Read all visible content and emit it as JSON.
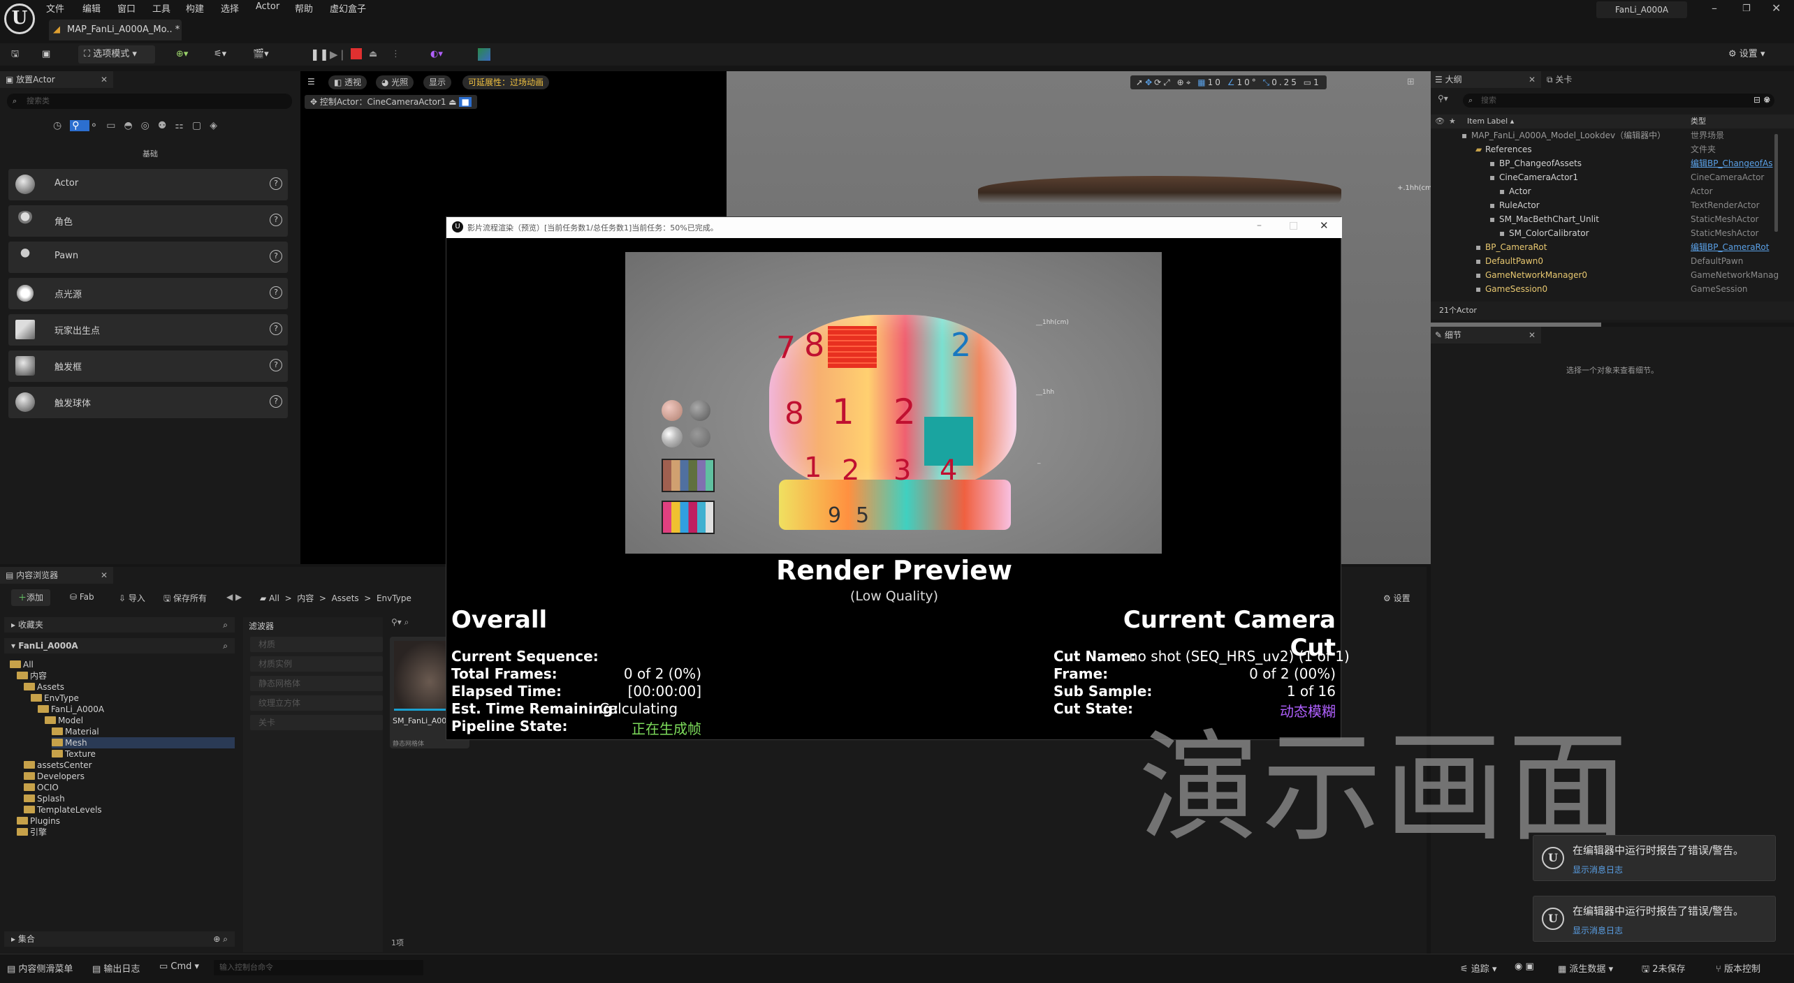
{
  "menu": [
    "文件",
    "编辑",
    "窗口",
    "工具",
    "构建",
    "选择",
    "Actor",
    "帮助",
    "虚幻盒子"
  ],
  "level_tab": "MAP_FanLi_A000A_Mo..",
  "project_name": "FanLi_A000A",
  "toolbar": {
    "mode": "选项模式",
    "settings": "设置"
  },
  "place_actors": {
    "title": "放置Actor",
    "search_placeholder": "搜索类",
    "category": "基础",
    "items": [
      "Actor",
      "角色",
      "Pawn",
      "点光源",
      "玩家出生点",
      "触发框",
      "触发球体"
    ]
  },
  "viewport": {
    "perspective": "透视",
    "lit": "光照",
    "show": "显示",
    "scalability": "可延展性：过场动画",
    "pilot": "控制Actor：CineCameraActor1",
    "grid": "10",
    "angle": "10°",
    "scale": "0.25",
    "camera_speed": "1",
    "overlay_text": "+.1hh(cm)"
  },
  "outliner": {
    "title": "大纲",
    "tab2": "关卡",
    "search_placeholder": "搜索",
    "col_label": "Item Label ▴",
    "col_type": "类型",
    "count": "21个Actor",
    "rows": [
      {
        "label": "MAP_FanLi_A000A_Model_Lookdev（编辑器中）",
        "type": "世界场景",
        "link": false,
        "dim": true
      },
      {
        "label": "References",
        "type": "文件夹",
        "link": false,
        "dim": false
      },
      {
        "label": "BP_ChangeofAssets",
        "type": "编辑BP_ChangeofAs",
        "link": true,
        "dim": false
      },
      {
        "label": "CineCameraActor1",
        "type": "CineCameraActor",
        "link": false,
        "dim": false
      },
      {
        "label": "Actor",
        "type": "Actor",
        "link": false,
        "dim": false
      },
      {
        "label": "RuleActor",
        "type": "TextRenderActor",
        "link": false,
        "dim": false
      },
      {
        "label": "SM_MacBethChart_Unlit",
        "type": "StaticMeshActor",
        "link": false,
        "dim": false
      },
      {
        "label": "SM_ColorCalibrator",
        "type": "StaticMeshActor",
        "link": false,
        "dim": false
      },
      {
        "label": "BP_CameraRot",
        "type": "编辑BP_CameraRot",
        "link": true,
        "dim": false
      },
      {
        "label": "DefaultPawn0",
        "type": "DefaultPawn",
        "link": false,
        "dim": false
      },
      {
        "label": "GameNetworkManager0",
        "type": "GameNetworkManag",
        "link": false,
        "dim": false
      },
      {
        "label": "GameSession0",
        "type": "GameSession",
        "link": false,
        "dim": false
      }
    ]
  },
  "details": {
    "title": "细节",
    "hint": "选择一个对象来查看细节。"
  },
  "content_browser": {
    "title": "内容浏览器",
    "add": "添加",
    "fab": "Fab",
    "import": "导入",
    "save_all": "保存所有",
    "path": [
      "All",
      "内容",
      "Assets",
      "EnvType"
    ],
    "settings": "设置",
    "favorites": "收藏夹",
    "project": "FanLi_A000A",
    "filters": "滤波器",
    "filter_items": [
      "材质",
      "材质实例",
      "静态网格体",
      "纹理立方体",
      "关卡"
    ],
    "tree": [
      "All",
      "内容",
      "Assets",
      "EnvType",
      "FanLi_A000A",
      "Model",
      "Material",
      "Mesh",
      "Texture",
      "assetsCenter",
      "Developers",
      "OCIO",
      "Splash",
      "TemplateLevels",
      "Plugins",
      "引擎"
    ],
    "collections": "集合",
    "asset_name": "SM_FanLi_A00",
    "asset_type": "静态网格体",
    "item_count": "1项"
  },
  "mrq": {
    "title": "影片流程渲染（预览）[当前任务数1/总任务数1]当前任务：50%已完成。",
    "render_title": "Render Preview",
    "quality": "(Low Quality)",
    "overall": "Overall",
    "camera_cut": "Current Camera Cut",
    "left": [
      {
        "k": "Current Sequence:",
        "v": ""
      },
      {
        "k": "Total Frames:",
        "v": "0 of 2 (0%)"
      },
      {
        "k": "Elapsed Time:",
        "v": "[00:00:00]"
      },
      {
        "k": "Est. Time Remaining:",
        "v": "Calculating"
      },
      {
        "k": "Pipeline State:",
        "v": "正在生成帧"
      }
    ],
    "right": [
      {
        "k": "Cut Name:",
        "v": "no shot (SEQ_HRS_uv2) (1 of 1)"
      },
      {
        "k": "Frame:",
        "v": "0 of 2 (00%)"
      },
      {
        "k": "Sub Sample:",
        "v": "1 of 16"
      },
      {
        "k": "Cut State:",
        "v": "动态模糊"
      }
    ],
    "pot_digits": [
      "7",
      "8",
      "2",
      "8",
      "1",
      "2",
      "1",
      "2",
      "3",
      "4",
      "9",
      "5"
    ],
    "ruler_marks": [
      "__1hh(cm)",
      "__1hh",
      "_"
    ]
  },
  "watermark": "演示画面",
  "toasts": [
    {
      "msg": "在编辑器中运行时报告了错误/警告。",
      "link": "显示消息日志"
    },
    {
      "msg": "在编辑器中运行时报告了错误/警告。",
      "link": "显示消息日志"
    }
  ],
  "statusbar": {
    "drawer": "内容侧滑菜单",
    "output_log": "输出日志",
    "cmd": "Cmd",
    "console_placeholder": "输入控制台命令",
    "trace": "追踪",
    "derived": "派生数据",
    "unsaved": "2未保存",
    "version": "版本控制"
  },
  "colors": {
    "accent": "#0070e0",
    "link": "#5aa0e6",
    "green": "#7ddc5b",
    "purple": "#b060ff"
  }
}
